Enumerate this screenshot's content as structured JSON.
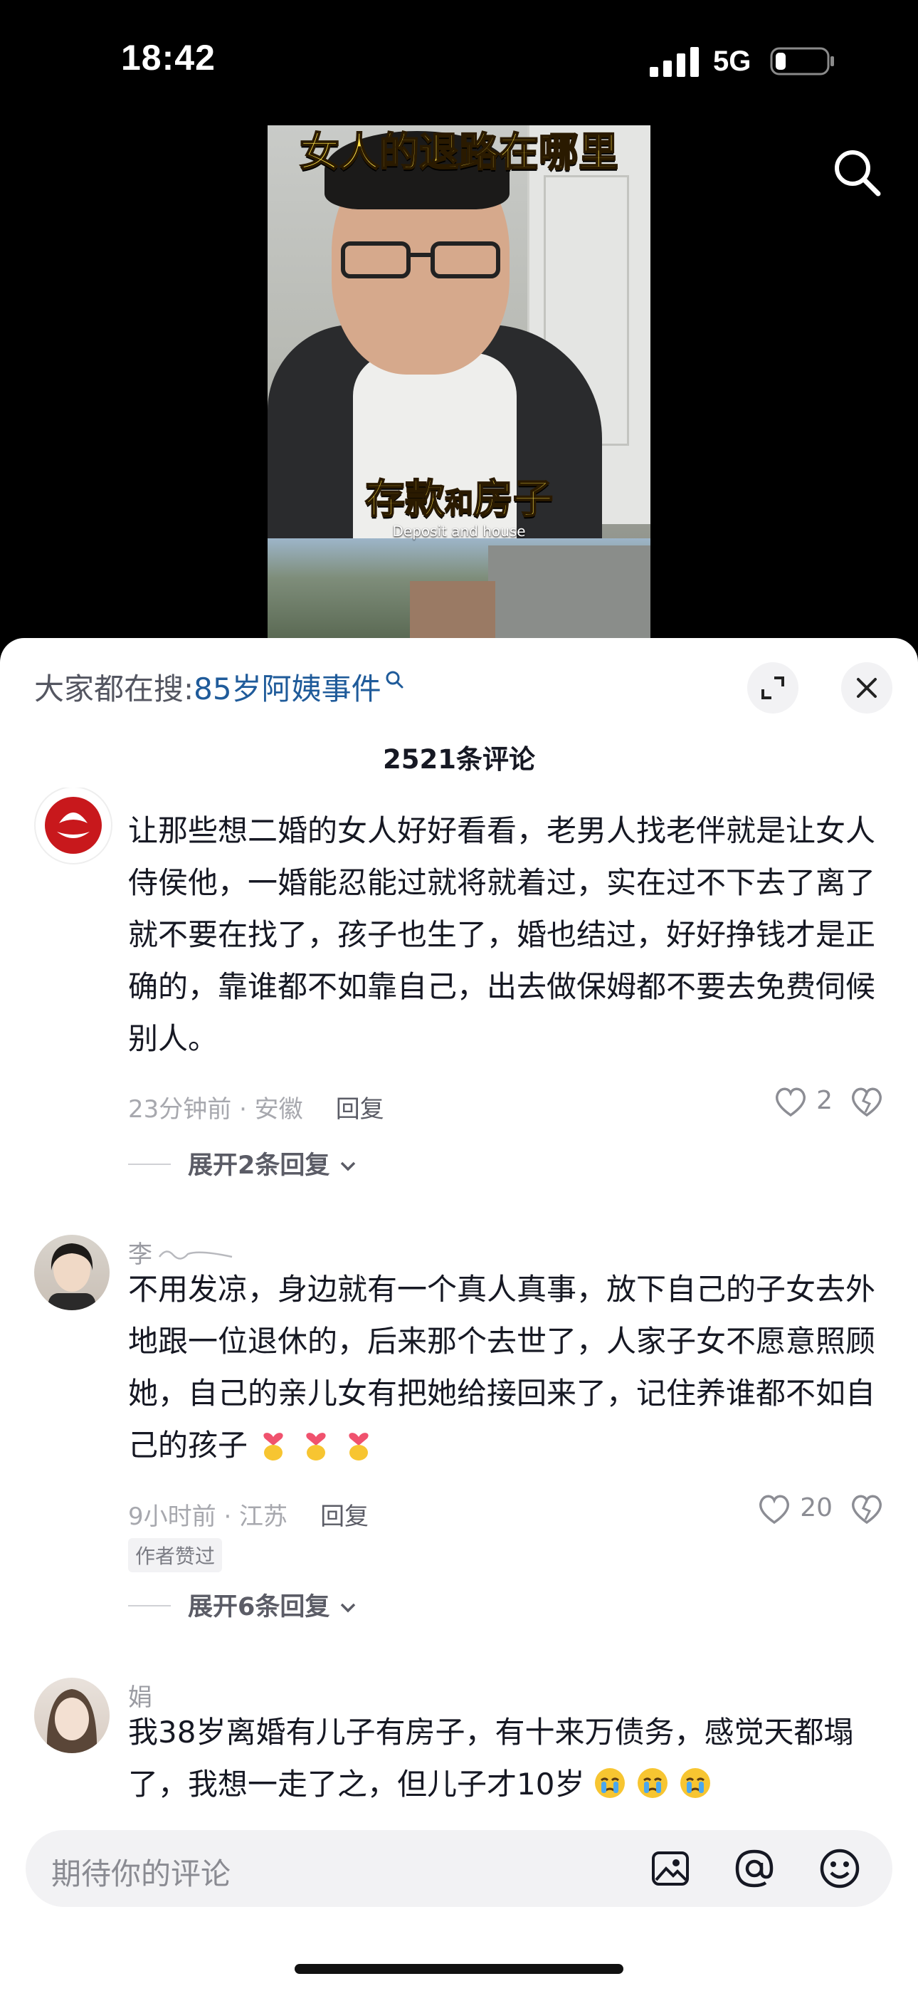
{
  "status_bar": {
    "time": "18:42",
    "network": "5G"
  },
  "video": {
    "title": "女人的退路在哪里",
    "subtitle_a": "存款",
    "subtitle_conj": "和",
    "subtitle_b": "房子",
    "subtitle_en": "Deposit and house"
  },
  "sheet": {
    "search_prefix": "大家都在搜:",
    "search_term": "85岁阿姨事件",
    "comment_count": "2521条评论"
  },
  "comments": [
    {
      "username": "",
      "text": "让那些想二婚的女人好好看看，老男人找老伴就是让女人侍侯他，一婚能忍能过就将就着过，实在过不下去了离了就不要在找了，孩子也生了，婚也结过，好好挣钱才是正确的，靠谁都不如靠自己，出去做保姆都不要去免费伺候别人。",
      "meta": "23分钟前 · 安徽",
      "reply_label": "回复",
      "likes": "2",
      "expand_label": "展开2条回复"
    },
    {
      "username": "李",
      "text": "不用发凉，身边就有一个真人真事，放下自己的子女去外地跟一位退休的，后来那个去世了，人家子女不愿意照顾她，自己的亲儿女有把她给接回来了，记住养谁都不如自己的孩子",
      "meta": "9小时前 · 江苏",
      "reply_label": "回复",
      "likes": "20",
      "author_tag": "作者赞过",
      "expand_label": "展开6条回复"
    },
    {
      "username": "娟",
      "text": "我38岁离婚有儿子有房子，有十来万债务，感觉天都塌了，我想一走了之，但儿子才10岁"
    }
  ],
  "input": {
    "placeholder": "期待你的评论"
  },
  "icons": [
    "search-icon",
    "expand-icon",
    "close-icon",
    "heart-icon",
    "dislike-icon",
    "image-icon",
    "at-icon",
    "emoji-icon"
  ]
}
